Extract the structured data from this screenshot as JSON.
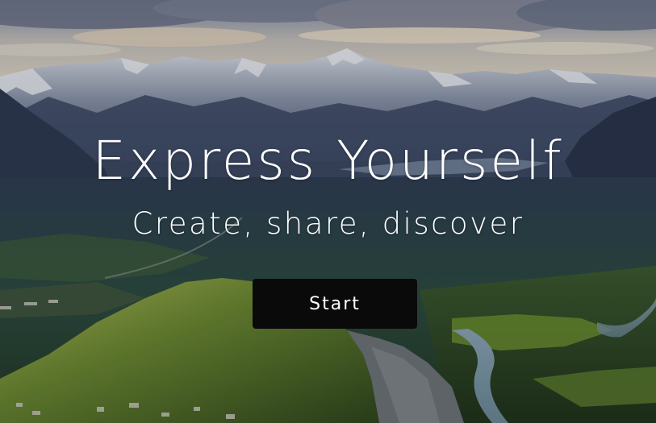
{
  "hero": {
    "title": "Express Yourself",
    "subtitle": "Create, share, discover",
    "start_label": "Start"
  },
  "colors": {
    "title_text": "#ffffff",
    "button_bg": "#0a0a0a",
    "button_text": "#ffffff"
  }
}
